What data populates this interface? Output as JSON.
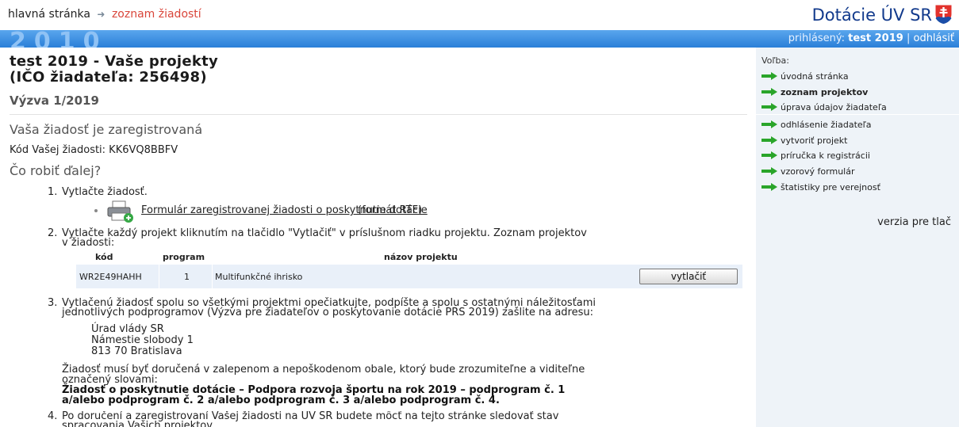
{
  "header": {
    "breadcrumb_home": "hlavná stránka",
    "breadcrumb_separator": "➜",
    "breadcrumb_current": "zoznam žiadostí",
    "site_title": "Dotácie ÚV SR",
    "year_decoration": "2010",
    "logged_in_label": "prihlásený:",
    "logged_in_user": "test 2019",
    "divider": "|",
    "logout": "odhlásiť"
  },
  "main": {
    "title_line1": "test 2019 - Vaše projekty",
    "title_line2": "(IČO žiadateľa: 256498)",
    "call": "Výzva 1/2019",
    "status": "Vaša žiadosť je zaregistrovaná",
    "code_text": "Kód Vašej žiadosti: KK6VQ8BBFV",
    "next_heading": "Čo robiť ďalej?",
    "step1_num": "1.",
    "step1_text": "Vytlačte žiadosť.",
    "form_link": "Formulár zaregistrovanej žiadosti o poskytnutie dotácie",
    "form_note": "(formát RTF)",
    "step2_num": "2.",
    "step2_line1": "Vytlačte každý projekt kliknutím na tlačidlo \"Vytlačiť\" v príslušnom riadku projektu. Zoznam projektov",
    "step2_line2": "v žiadosti:",
    "table": {
      "headers": [
        "kód",
        "program",
        "názov projektu"
      ],
      "rows": [
        {
          "code": "WR2E49HAHH",
          "program": "1",
          "name": "Multifunkčné ihrisko",
          "button": "vytlačiť"
        }
      ]
    },
    "step3_num": "3.",
    "step3_line1": "Vytlačenú žiadosť spolu so všetkými projektmi opečiatkujte, podpíšte a spolu s ostatnými náležitosťami",
    "step3_line2": "jednotlivých podprogramov (Výzva pre žiadateľov o poskytovanie dotácie PRS 2019) zašlite na adresu:",
    "address": [
      "Úrad vlády SR",
      "Námestie slobody 1",
      "813 70 Bratislava"
    ],
    "para_line1": "Žiadosť musí byť doručená v zalepenom a nepoškodenom obale, ktorý bude zrozumiteľne a viditeľne",
    "para_line2": "označený slovami:",
    "bold_line1": "Žiadosť o poskytnutie dotácie – Podpora rozvoja športu na rok 2019 – podprogram č. 1",
    "bold_line2": "a/alebo podprogram č. 2 a/alebo podprogram č. 3 a/alebo podprogram č. 4.",
    "step4_num": "4.",
    "step4_line1": "Po doručení a zaregistrovaní Vašej žiadosti na ÚV SR budete môcť na tejto stránke sledovať stav",
    "step4_line2": "spracovania Vašich projektov."
  },
  "sidebar": {
    "title": "Voľba:",
    "items": [
      {
        "label": "úvodná stránka"
      },
      {
        "label": "zoznam projektov"
      },
      {
        "label": "úprava údajov žiadateľa"
      },
      {
        "label": "odhlásenie žiadateľa"
      },
      {
        "label": "vytvoriť projekt"
      },
      {
        "label": "príručka k registrácii"
      },
      {
        "label": "vzorový formulár"
      },
      {
        "label": "štatistiky pre verejnosť"
      }
    ],
    "print_version": "verzia pre tlač"
  },
  "colors": {
    "accent_blue": "#2a7fd8",
    "breadcrumb_current": "#d9453a",
    "site_title": "#123a8c",
    "arrow_green": "#2aa52a",
    "sidebar_bg": "#eef3f8"
  }
}
